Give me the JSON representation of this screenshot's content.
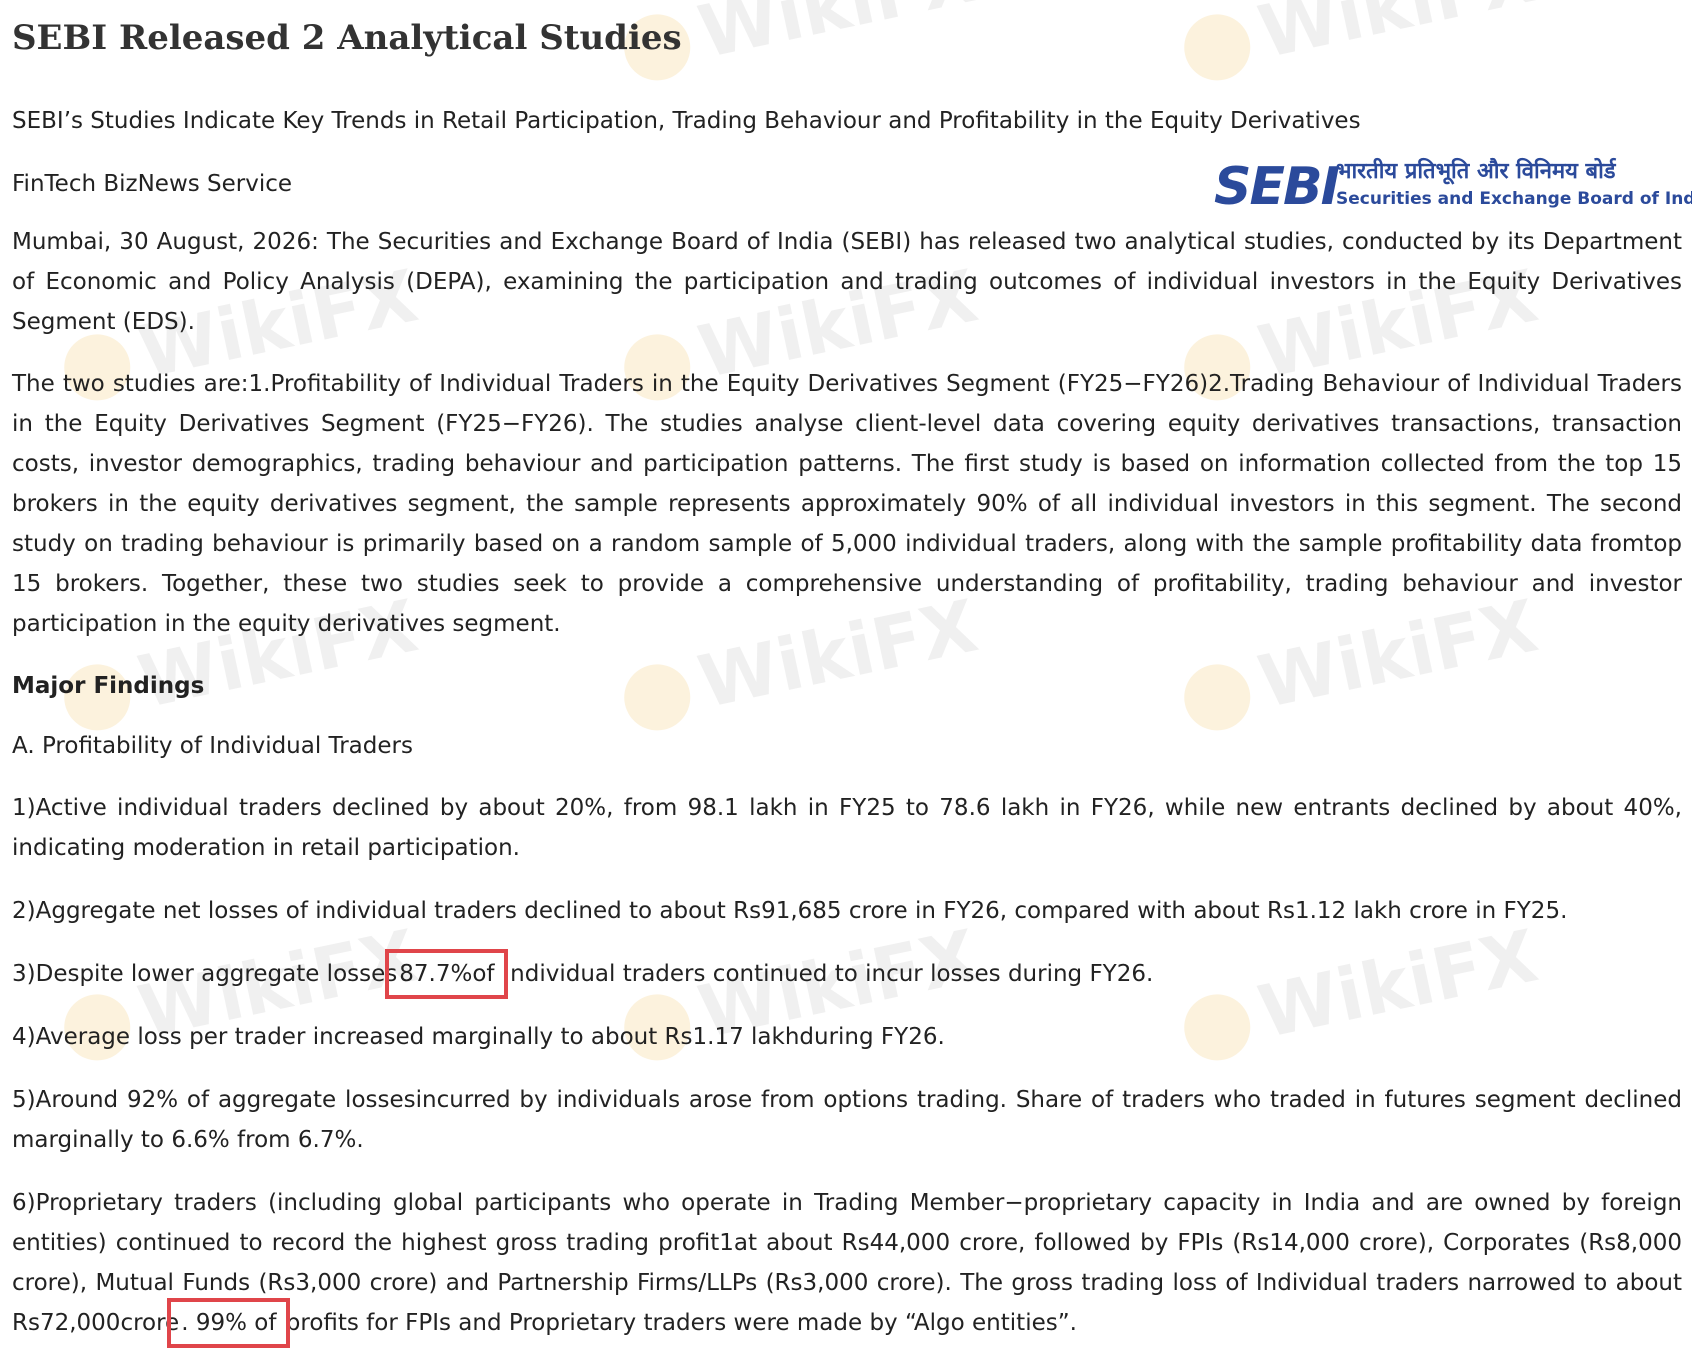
{
  "article": {
    "title": "SEBI Released 2 Analytical Studies",
    "subtitle": "SEBI’s Studies Indicate Key Trends in Retail Participation, Trading Behaviour and Profitability in the Equity Derivatives",
    "byline": "FinTech BizNews Service",
    "logo": {
      "mark": "SEBI",
      "hindi": "भारतीय प्रतिभूति और विनिमय बोर्ड",
      "english": "Securities and Exchange Board of India"
    },
    "intro": "Mumbai, 30 August, 2026: The Securities and Exchange Board of India (SEBI) has released two analytical studies, conducted by its Department of Economic and Policy Analysis (DEPA), examining the participation and trading outcomes of individual investors in the Equity Derivatives Segment (EDS).",
    "studies": "The two studies are:1.Profitability of Individual Traders in the Equity Derivatives Segment (FY25−FY26)2.Trading Behaviour of Individual Traders in the Equity Derivatives Segment (FY25−FY26). The studies analyse client-level data covering equity derivatives transactions, transaction costs, investor demographics, trading behaviour and participation patterns. The first study is based on information collected from the top 15 brokers in the equity derivatives segment, the sample represents approximately 90% of all individual investors in this segment. The second study on trading behaviour is primarily based on a random sample of 5,000 individual traders, along with the sample profitability data fromtop 15 brokers. Together, these two studies seek to provide a comprehensive understanding of profitability, trading behaviour and investor participation in the equity derivatives segment.",
    "major_findings": "Major Findings",
    "section_a": "A. Profitability of Individual Traders",
    "findings": {
      "f1": "1)Active individual traders declined by about 20%, from 98.1 lakh in FY25 to 78.6 lakh in FY26, while new entrants declined by about 40%, indicating moderation in retail participation.",
      "f2": "2)Aggregate net losses of individual traders declined to about Rs91,685 crore in FY26, compared with about Rs1.12 lakh crore in FY25.",
      "f3_pre": "3)Despite lower aggregate losses",
      "f3_hl": "87.7%of",
      "f3_post": " individual traders continued to incur losses during FY26.",
      "f4": "4)Average loss per trader increased marginally to about Rs1.17 lakhduring FY26.",
      "f5": "5)Around 92% of aggregate lossesincurred by individuals arose from options trading. Share of traders who traded in futures segment declined marginally to 6.6% from 6.7%.",
      "f6_pre": "6)Proprietary traders (including global participants who operate in Trading Member−proprietary capacity in India and are owned by foreign entities) continued to record the highest gross trading profit1at about Rs44,000 crore, followed by FPIs (Rs14,000 crore), Corporates (Rs8,000 crore), Mutual Funds (Rs3,000 crore) and Partnership Firms/LLPs (Rs3,000 crore). The gross trading loss of Individual traders narrowed to about Rs72,000crore",
      "f6_hl": ". 99% of",
      "f6_post": " profits for FPIs and Proprietary traders were made by “Algo entities”."
    },
    "watermark": "WikiFX"
  }
}
